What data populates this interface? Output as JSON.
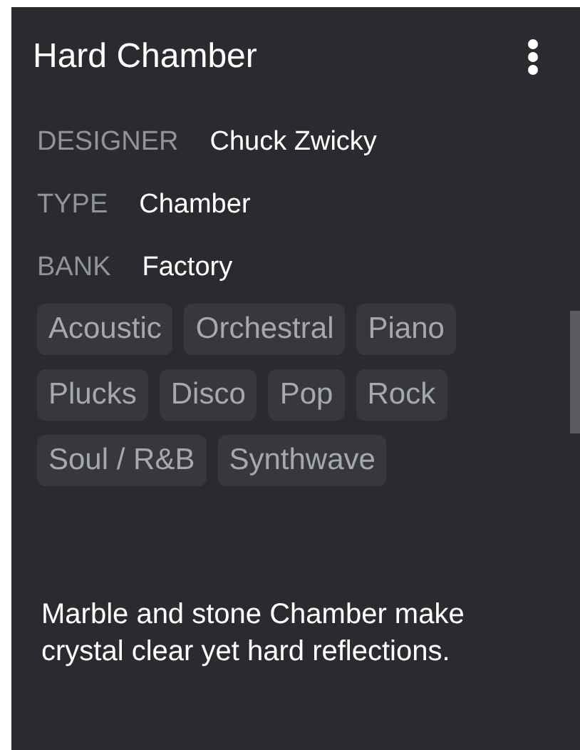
{
  "title": "Hard Chamber",
  "fields": [
    {
      "label": "DESIGNER",
      "value": "Chuck Zwicky"
    },
    {
      "label": "TYPE",
      "value": "Chamber"
    },
    {
      "label": "BANK",
      "value": "Factory"
    }
  ],
  "tags": [
    "Acoustic",
    "Orchestral",
    "Piano",
    "Plucks",
    "Disco",
    "Pop",
    "Rock",
    "Soul / R&B",
    "Synthwave"
  ],
  "description": "Marble and stone Chamber make crystal clear yet hard reflections."
}
